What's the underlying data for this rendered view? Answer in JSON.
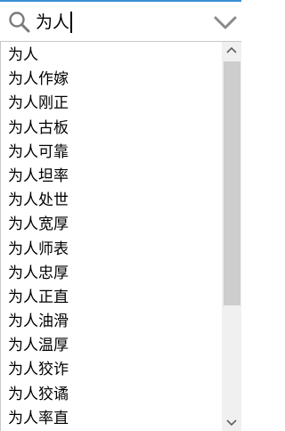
{
  "search": {
    "value": "为人",
    "icon": "search-icon",
    "dropdown_icon": "chevron-down-icon"
  },
  "suggestions": [
    "为人",
    "为人作嫁",
    "为人刚正",
    "为人古板",
    "为人可靠",
    "为人坦率",
    "为人处世",
    "为人宽厚",
    "为人师表",
    "为人忠厚",
    "为人正直",
    "为人油滑",
    "为人温厚",
    "为人狡诈",
    "为人狡谲",
    "为人率直"
  ],
  "colors": {
    "accent_border": "#3b8fd6",
    "scrollbar_track": "#f0f0f0",
    "scrollbar_thumb": "#cdcdcd",
    "icon_gray": "#808080"
  }
}
